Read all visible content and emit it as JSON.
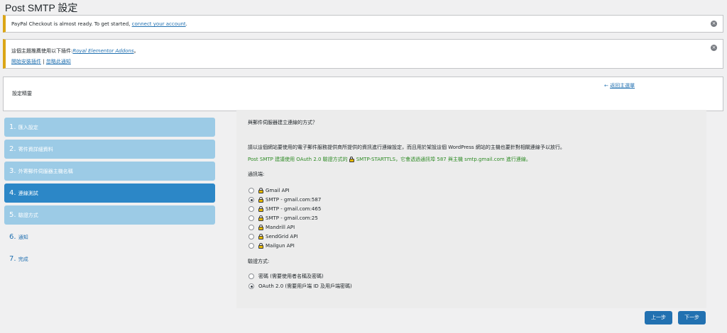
{
  "page_title": "Post SMTP 設定",
  "notices": {
    "paypal": {
      "text": "PayPal Checkout is almost ready. To get started,",
      "link": "connect your account",
      "suffix": "."
    },
    "theme": {
      "text": "這個主題推薦使用以下插件:",
      "plugin_link": "Royal Elementor Addons",
      "suffix": "。",
      "install_link": "開始安裝插件",
      "separator": "|",
      "dismiss_link": "忽略此通知"
    },
    "dismiss_icon": "close-circle-icon"
  },
  "settings": {
    "title": "設定精靈",
    "back_arrow": "←",
    "back_label": "返回主選單"
  },
  "steps": [
    {
      "num": "1.",
      "label": "匯入設定"
    },
    {
      "num": "2.",
      "label": "寄件資詳細資料"
    },
    {
      "num": "3.",
      "label": "外寄郵件伺服器主機名稱"
    },
    {
      "num": "4.",
      "label": "連線測試"
    },
    {
      "num": "5.",
      "label": "驗證方式"
    },
    {
      "num": "6.",
      "label": "通知"
    },
    {
      "num": "7.",
      "label": "完成"
    }
  ],
  "panel": {
    "heading": "與郵件伺服器建立連線的方式？",
    "description": "請以這個網站要使用的電子郵件服務提供商所提供的資訊進行連線設定，而且用於架設這個 WordPress 網站的主機也要針對相關連線予以放行。",
    "green_prefix": "Post SMTP 建議使用 OAuth 2.0 驗證方式的",
    "green_method": "SMTP-STARTTLS",
    "green_suffix": "，它會透過通訊埠 587 與主機 smtp.gmail.com 進行連線。",
    "transport_label": "通訊端:",
    "transports": [
      {
        "label": "Gmail API",
        "checked": false
      },
      {
        "label": "SMTP - gmail.com:587",
        "checked": true
      },
      {
        "label": "SMTP - gmail.com:465",
        "checked": false
      },
      {
        "label": "SMTP - gmail.com:25",
        "checked": false
      },
      {
        "label": "Mandrill API",
        "checked": false
      },
      {
        "label": "SendGrid API",
        "checked": false
      },
      {
        "label": "Mailgun API",
        "checked": false
      }
    ],
    "auth_label": "驗證方式:",
    "auth_options": [
      {
        "label": "密碼 (需要使用者名稱及密碼)",
        "checked": false
      },
      {
        "label": "OAuth 2.0 (需要用戶端 ID 及用戶端密碼)",
        "checked": true
      }
    ],
    "lock_icon": "lock-icon"
  },
  "buttons": {
    "prev": "上一步",
    "next": "下一步"
  },
  "colors": {
    "primary": "#2271b1",
    "step_active": "#2c87c7",
    "step_inactive": "#9ccbe6",
    "notice_warning": "#dba617",
    "recommend_green": "#2e8b25"
  }
}
